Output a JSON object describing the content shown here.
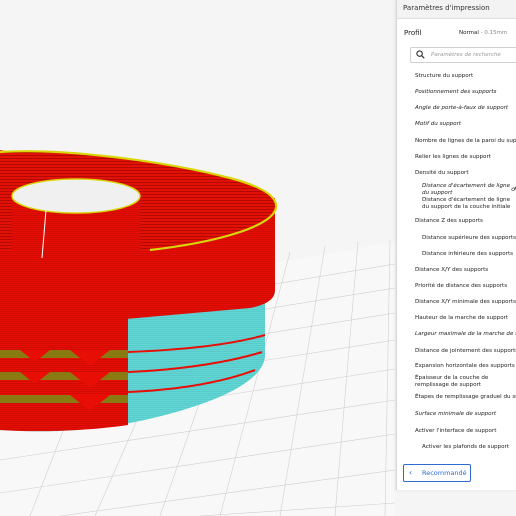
{
  "panel": {
    "title": "Paramètres d'impression",
    "profile_label": "Profil",
    "profile_value": "Normal",
    "profile_value_detail": "- 0.15mm",
    "search_placeholder": "Paramètres de recherche",
    "recommended_label": "Recommandé"
  },
  "settings": [
    {
      "label": "Structure du support",
      "italic": false,
      "indent": false
    },
    {
      "label": "Positionnement des supports",
      "italic": true,
      "indent": false
    },
    {
      "label": "Angle de porte-à-faux de support",
      "italic": true,
      "indent": false
    },
    {
      "label": "Motif du support",
      "italic": true,
      "indent": false
    },
    {
      "label": "Nombre de lignes de la paroi du support",
      "italic": false,
      "indent": false
    },
    {
      "label": "Relier les lignes de support",
      "italic": false,
      "indent": false
    },
    {
      "label": "Densité du support",
      "italic": false,
      "indent": false
    },
    {
      "label": "Distance d'écartement de ligne du support",
      "italic": true,
      "indent": true
    },
    {
      "label": "Distance d'écartement de ligne du support de la couche initiale",
      "italic": false,
      "indent": true
    },
    {
      "label": "Distance Z des supports",
      "italic": false,
      "indent": false
    },
    {
      "label": "Distance supérieure des supports",
      "italic": false,
      "indent": true
    },
    {
      "label": "Distance inférieure des supports",
      "italic": false,
      "indent": true
    },
    {
      "label": "Distance X/Y des supports",
      "italic": false,
      "indent": false
    },
    {
      "label": "Priorité de distance des supports",
      "italic": false,
      "indent": false
    },
    {
      "label": "Distance X/Y minimale des supports",
      "italic": false,
      "indent": false
    },
    {
      "label": "Hauteur de la marche de support",
      "italic": false,
      "indent": false
    },
    {
      "label": "Largeur maximale de la marche de support",
      "italic": true,
      "indent": false
    },
    {
      "label": "Distance de jointement des supports",
      "italic": false,
      "indent": false
    },
    {
      "label": "Expansion horizontale des supports",
      "italic": false,
      "indent": false
    },
    {
      "label": "Épaisseur de la couche de remplissage de support",
      "italic": false,
      "indent": false
    },
    {
      "label": "Étapes de remplissage graduel du support",
      "italic": false,
      "indent": false
    },
    {
      "label": "Surface minimale de support",
      "italic": true,
      "indent": false
    },
    {
      "label": "Activer l'interface de support",
      "italic": false,
      "indent": false
    },
    {
      "label": "Activer les plafonds de support",
      "italic": false,
      "indent": true
    }
  ],
  "colors": {
    "model_red": "#e80e05",
    "model_yellow": "#d9d60a",
    "model_cyan": "#63d7d6",
    "model_olive": "#8a7a12",
    "build_plate": "#f7f7f7",
    "grid": "#c9c9c9",
    "accent": "#2d6bd0"
  },
  "icons": {
    "search": "magnifier-icon",
    "link": "link-icon",
    "back": "chevron-left-icon"
  }
}
